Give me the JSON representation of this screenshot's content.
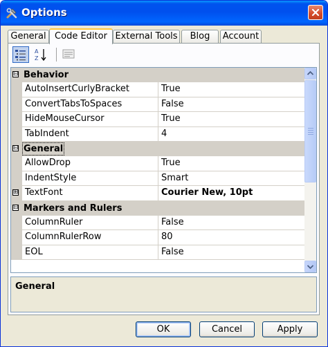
{
  "window": {
    "title": "Options"
  },
  "tabs": [
    {
      "label": "General",
      "active": false
    },
    {
      "label": "Code Editor",
      "active": true
    },
    {
      "label": "External Tools",
      "active": false
    },
    {
      "label": "Blog",
      "active": false
    },
    {
      "label": "Account",
      "active": false
    }
  ],
  "toolbar": {
    "categorized_icon": "categorized-view-icon",
    "alphabetical_icon": "alphabetical-sort-icon",
    "property_pages_icon": "property-pages-icon"
  },
  "property_grid": {
    "categories": [
      {
        "name": "Behavior",
        "expander": "⊟",
        "properties": [
          {
            "name": "AutoInsertCurlyBracket",
            "value": "True"
          },
          {
            "name": "ConvertTabsToSpaces",
            "value": "False"
          },
          {
            "name": "HideMouseCursor",
            "value": "True"
          },
          {
            "name": "TabIndent",
            "value": "4"
          }
        ]
      },
      {
        "name": "General",
        "expander": "⊟",
        "properties": [
          {
            "name": "AllowDrop",
            "value": "True"
          },
          {
            "name": "IndentStyle",
            "value": "Smart"
          },
          {
            "name": "TextFont",
            "value": "Courier New, 10pt",
            "expander": "⊞"
          }
        ]
      },
      {
        "name": "Markers and Rulers",
        "expander": "⊟",
        "properties": [
          {
            "name": "ColumnRuler",
            "value": "False"
          },
          {
            "name": "ColumnRulerRow",
            "value": "80"
          },
          {
            "name": "EOL",
            "value": "False"
          }
        ]
      }
    ]
  },
  "description": {
    "title": "General"
  },
  "buttons": {
    "ok": "OK",
    "cancel": "Cancel",
    "apply": "Apply"
  },
  "colors": {
    "titlebar": "#0054e3",
    "active_tab_highlight": "#ffc83c",
    "category_bg": "#d4d0c8"
  }
}
